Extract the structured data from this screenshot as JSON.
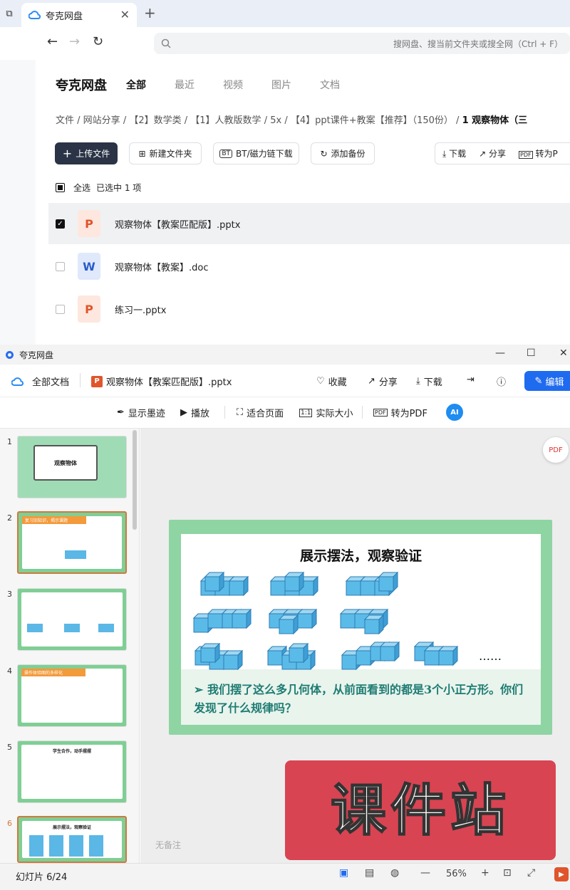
{
  "browser": {
    "tab_title": "夸克网盘",
    "search_placeholder": "搜网盘、搜当前文件夹或搜全网（Ctrl + F）"
  },
  "app": {
    "brand": "夸克网盘",
    "nav_tabs": [
      "全部",
      "最近",
      "视频",
      "图片",
      "文档"
    ],
    "breadcrumb": [
      "文件",
      "网站分享",
      "【2】数学类",
      "【1】人教版数学",
      "5x",
      "【4】ppt课件+教案【推荐】（150份）",
      "1 观察物体（三"
    ],
    "actions": {
      "upload": "上传文件",
      "new_folder": "新建文件夹",
      "bt": "BT/磁力链下载",
      "backup": "添加备份",
      "download": "下载",
      "share": "分享",
      "convert": "转为P"
    },
    "select_all": "全选",
    "selected_info": "已选中  1  项",
    "files": [
      {
        "name": "观察物体【教案匹配版】.pptx",
        "type": "P",
        "selected": true
      },
      {
        "name": "观察物体【教案】.doc",
        "type": "W",
        "selected": false
      },
      {
        "name": "练习一.pptx",
        "type": "P",
        "selected": false
      }
    ]
  },
  "viewer": {
    "window_title": "夸克网盘",
    "all_docs": "全部文档",
    "file_name": "观察物体【教案匹配版】.pptx",
    "favorite": "收藏",
    "share": "分享",
    "download": "下载",
    "edit": "编辑",
    "toolbar": {
      "ink": "显示墨迹",
      "play": "播放",
      "fit": "适合页面",
      "actual": "实际大小",
      "to_pdf": "转为PDF"
    },
    "thumbnails": [
      {
        "num": "1",
        "title": "观察物体"
      },
      {
        "num": "2",
        "title": "复习旧知识，揭示课题"
      },
      {
        "num": "3",
        "title": ""
      },
      {
        "num": "4",
        "title": "操作体验图的多样化"
      },
      {
        "num": "5",
        "title": "学生合作，动手摆摆"
      },
      {
        "num": "6",
        "title": "展示摆法，观察验证"
      }
    ],
    "slide": {
      "title": "展示摆法，观察验证",
      "text": "➢ 我们摆了这么多几何体，从前面看到的都是3个小正方形。你们发现了什么规律吗？",
      "ellipsis": "……",
      "watermark": "课件站"
    },
    "notes": "无备注",
    "status": {
      "slide_count": "幻灯片 6/24",
      "zoom": "56%"
    }
  }
}
